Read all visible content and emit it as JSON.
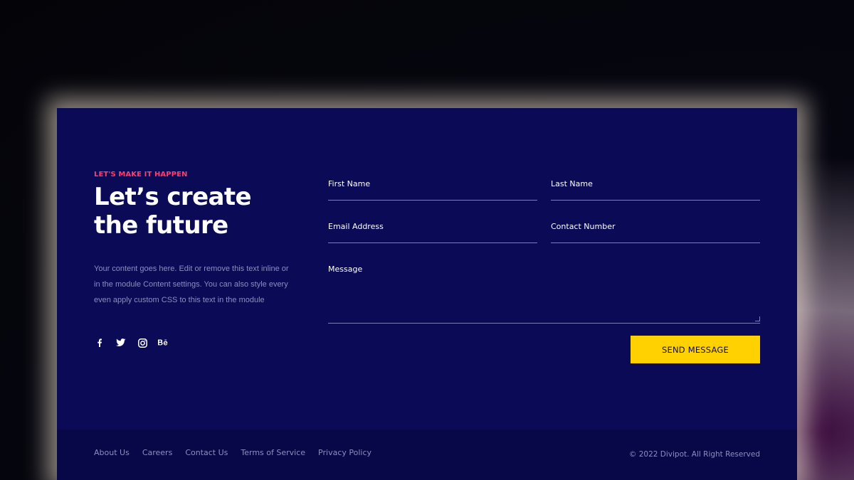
{
  "hero": {
    "eyebrow": "LET'S MAKE IT HAPPEN",
    "heading_line1": "Let’s create",
    "heading_line2": "the future",
    "desc_line1": "Your content goes here. Edit or remove this text inline or",
    "desc_line2": "in the module Content settings. You can also style every",
    "desc_line3": "even apply custom CSS to this text in the module"
  },
  "socials": [
    {
      "icon": "facebook-icon",
      "glyph": "f"
    },
    {
      "icon": "twitter-icon",
      "glyph": "t"
    },
    {
      "icon": "instagram-icon",
      "glyph": "ig"
    },
    {
      "icon": "behance-icon",
      "glyph": "Bē"
    }
  ],
  "form": {
    "first_name_label": "First Name",
    "last_name_label": "Last Name",
    "email_label": "Email Address",
    "contact_label": "Contact Number",
    "message_label": "Message",
    "send_label": "SEND MESSAGE"
  },
  "footer": {
    "links": [
      "About Us",
      "Careers",
      "Contact Us",
      "Terms of Service",
      "Privacy Policy"
    ],
    "copyright": "© 2022 Divipot. All Right Reserved"
  },
  "colors": {
    "card_bg": "#0a0a56",
    "accent_pink": "#ff3d6e",
    "button_yellow": "#ffd100"
  }
}
